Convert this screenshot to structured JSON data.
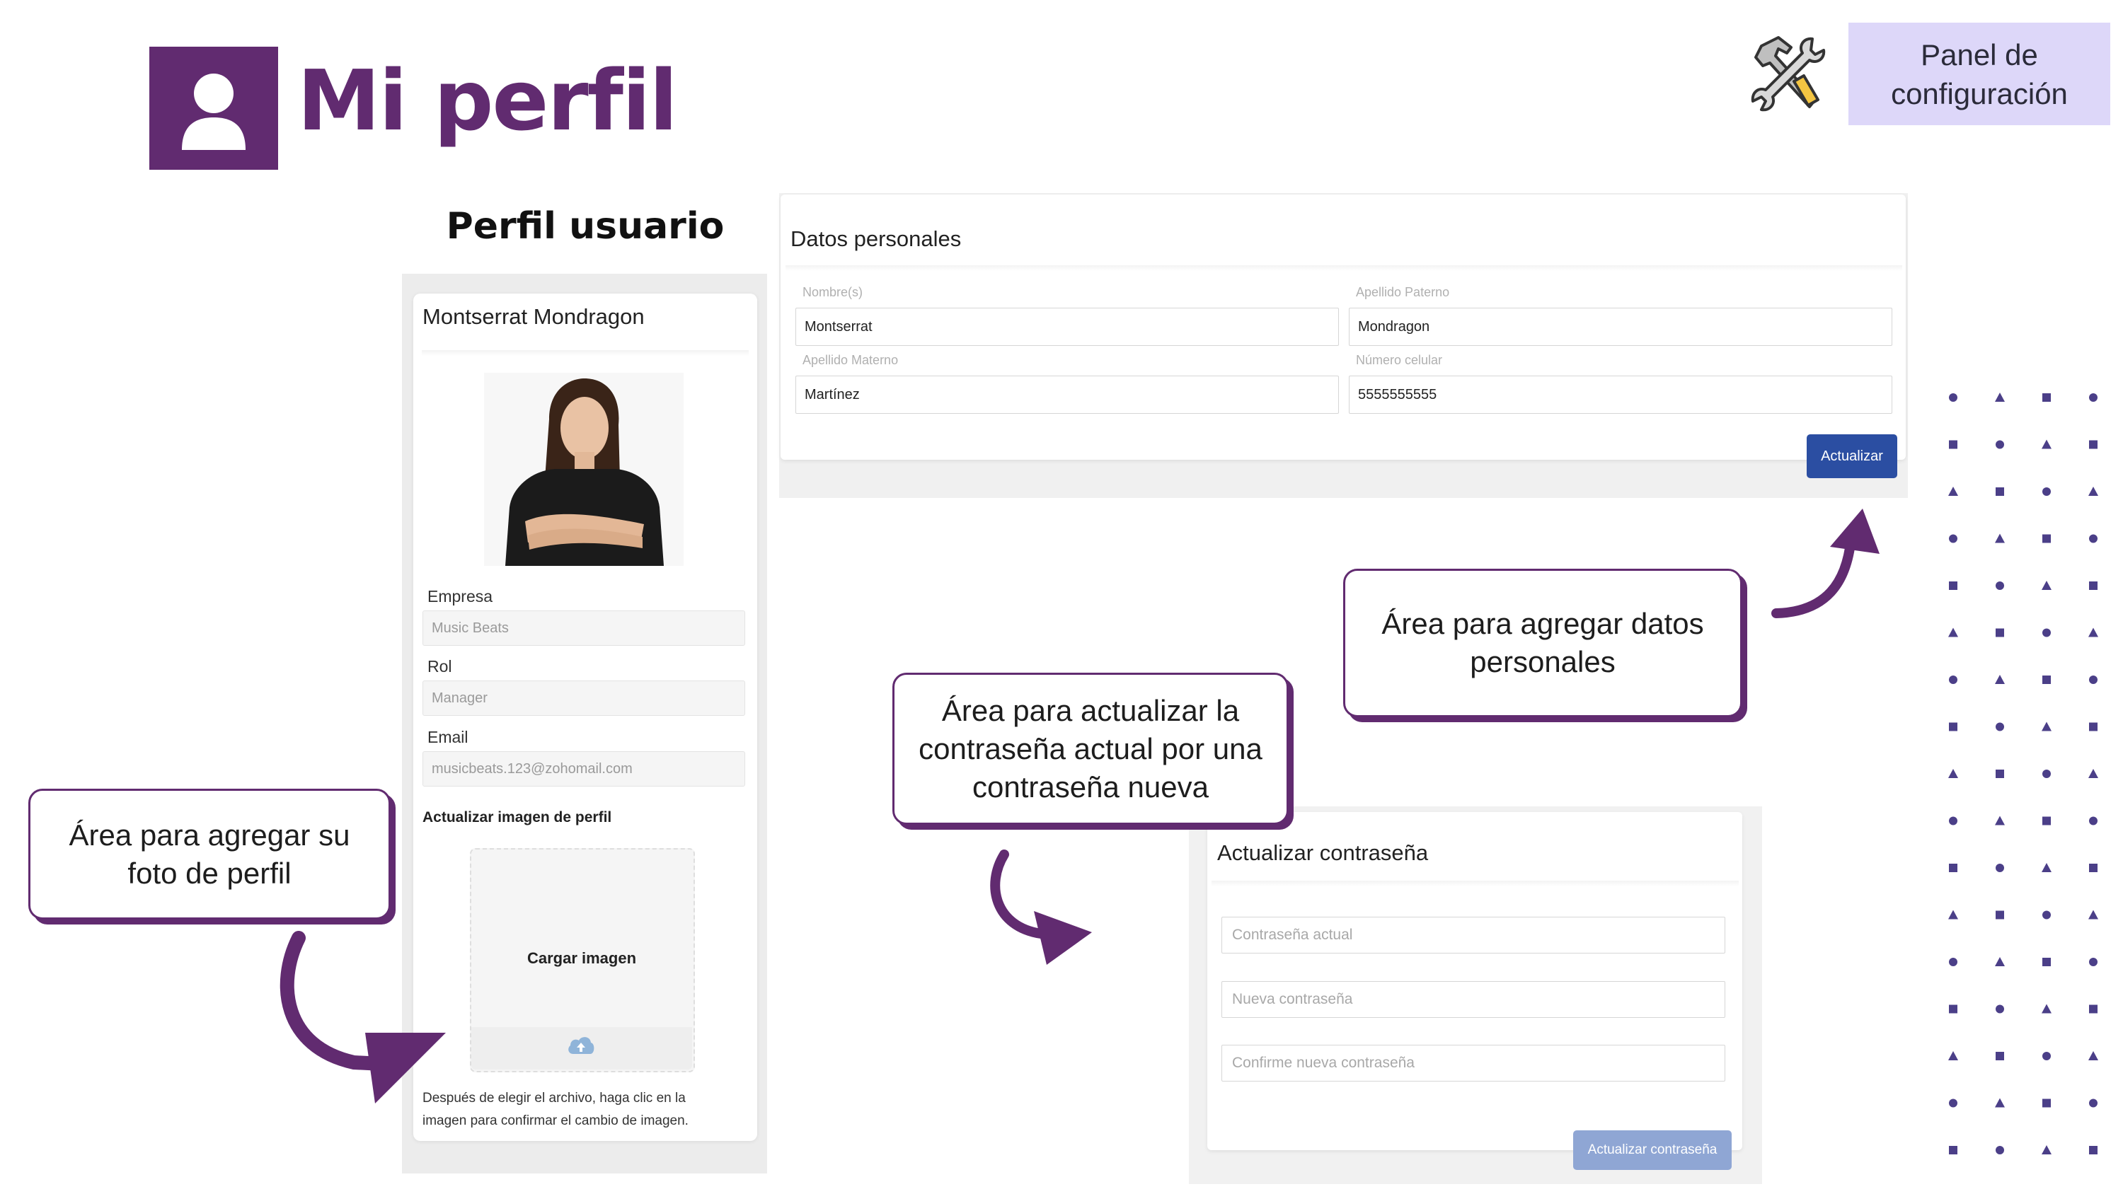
{
  "header": {
    "title": "Mi perfil",
    "config_panel_label": "Panel de configuración",
    "icons": {
      "profile": "user-icon",
      "tools": "hammer-wrench-icon"
    }
  },
  "section_title": "Perfil usuario",
  "profile": {
    "name": "Montserrat Mondragon",
    "fields": [
      {
        "label": "Empresa",
        "value": "Music Beats"
      },
      {
        "label": "Rol",
        "value": "Manager"
      },
      {
        "label": "Email",
        "value": "musicbeats.123@zohomail.com"
      }
    ],
    "update_photo_label": "Actualizar imagen de perfil",
    "upload_label": "Cargar imagen",
    "upload_icon": "cloud-upload-icon",
    "instruction": "Después de elegir el archivo, haga clic en la imagen para confirmar el cambio de imagen."
  },
  "personal_data": {
    "title": "Datos personales",
    "fields": [
      {
        "label": "Nombre(s)",
        "value": "Montserrat"
      },
      {
        "label": "Apellido Paterno",
        "value": "Mondragon"
      },
      {
        "label": "Apellido Materno",
        "value": "Martínez"
      },
      {
        "label": "Número celular",
        "value": "5555555555"
      }
    ],
    "button_label": "Actualizar"
  },
  "password": {
    "title": "Actualizar contraseña",
    "placeholders": [
      "Contraseña actual",
      "Nueva contraseña",
      "Confirme nueva contraseña"
    ],
    "button_label": "Actualizar contraseña"
  },
  "callouts": {
    "photo": "Área para agregar su foto de perfil",
    "password": "Área para actualizar la contraseña actual por una contraseña nueva",
    "personal": "Área para agregar datos personales"
  },
  "colors": {
    "brand_purple": "#612b70",
    "panel_bg": "#ddd7f9",
    "primary_button": "#2b4ea2",
    "disabled_button": "#8fa6d4",
    "dot_pattern": "#4b3f88"
  }
}
